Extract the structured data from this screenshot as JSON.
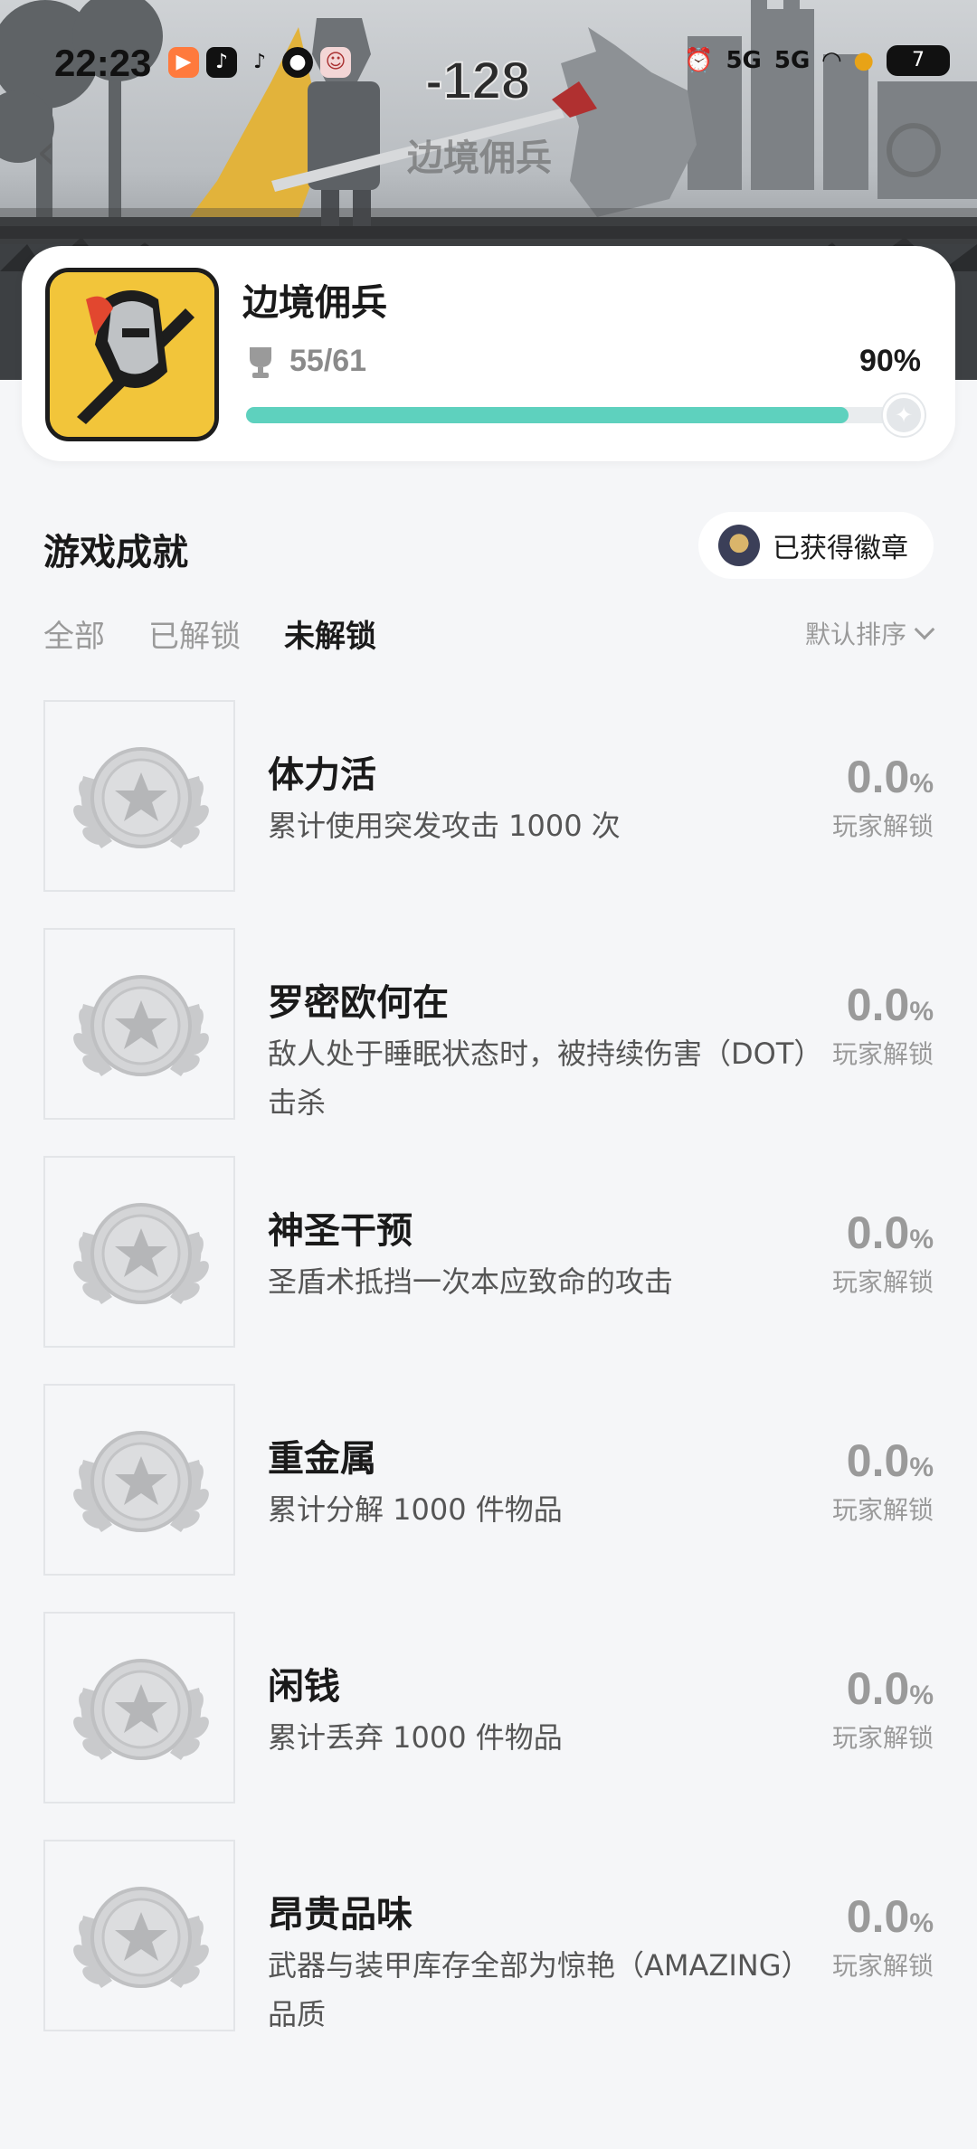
{
  "status_bar": {
    "time": "22:23",
    "network_1": "5G",
    "network_2": "5G",
    "battery": "7"
  },
  "hero": {
    "number": "-128",
    "title": "边境佣兵"
  },
  "game": {
    "name": "边境佣兵",
    "unlocked_count": "55/61",
    "percent_label": "90%",
    "progress": 0.9,
    "accent_color": "#5ed1be"
  },
  "section": {
    "title": "游戏成就",
    "badge_button": "已获得徽章"
  },
  "tabs": [
    {
      "label": "全部",
      "active": false
    },
    {
      "label": "已解锁",
      "active": false
    },
    {
      "label": "未解锁",
      "active": true
    }
  ],
  "sort": {
    "label": "默认排序"
  },
  "achievements": [
    {
      "name": "体力活",
      "desc": "累计使用突发攻击 1000 次",
      "rate": "0.0",
      "rate_unit": "%",
      "rate_label": "玩家解锁"
    },
    {
      "name": "罗密欧何在",
      "desc": "敌人处于睡眠状态时，被持续伤害（DOT）击杀",
      "rate": "0.0",
      "rate_unit": "%",
      "rate_label": "玩家解锁"
    },
    {
      "name": "神圣干预",
      "desc": "圣盾术抵挡一次本应致命的攻击",
      "rate": "0.0",
      "rate_unit": "%",
      "rate_label": "玩家解锁"
    },
    {
      "name": "重金属",
      "desc": "累计分解 1000 件物品",
      "rate": "0.0",
      "rate_unit": "%",
      "rate_label": "玩家解锁"
    },
    {
      "name": "闲钱",
      "desc": "累计丢弃 1000 件物品",
      "rate": "0.0",
      "rate_unit": "%",
      "rate_label": "玩家解锁"
    },
    {
      "name": "昂贵品味",
      "desc": "武器与装甲库存全部为惊艳（AMAZING）品质",
      "rate": "0.0",
      "rate_unit": "%",
      "rate_label": "玩家解锁"
    }
  ]
}
